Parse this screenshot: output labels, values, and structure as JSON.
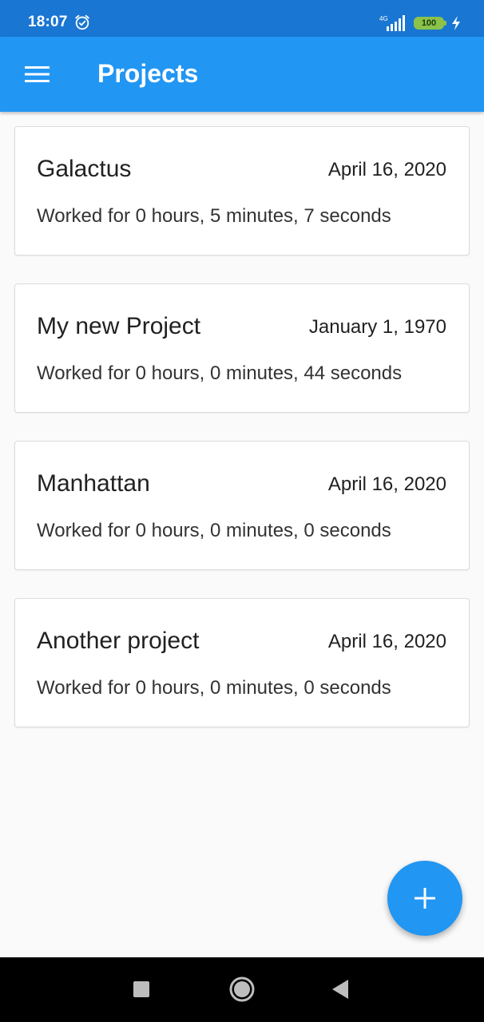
{
  "status_bar": {
    "time": "18:07",
    "battery_level": "100",
    "network_label": "4G",
    "icons": [
      "alarm-icon",
      "signal-icon",
      "battery-icon",
      "charging-icon"
    ]
  },
  "app_bar": {
    "title": "Projects",
    "menu_icon": "hamburger-menu-icon",
    "background_color": "#2196f3"
  },
  "projects": [
    {
      "name": "Galactus",
      "date": "April 16, 2020",
      "worked": "Worked for 0 hours, 5 minutes, 7 seconds"
    },
    {
      "name": "My new Project",
      "date": "January 1, 1970",
      "worked": "Worked for 0 hours, 0 minutes, 44 seconds"
    },
    {
      "name": "Manhattan",
      "date": "April 16, 2020",
      "worked": "Worked for 0 hours, 0 minutes, 0 seconds"
    },
    {
      "name": "Another project",
      "date": "April 16, 2020",
      "worked": "Worked for 0 hours, 0 minutes, 0 seconds"
    }
  ],
  "fab": {
    "icon": "plus-icon",
    "color": "#2196f3"
  },
  "nav_bar": {
    "icons": [
      "recents-icon",
      "home-icon",
      "back-icon"
    ]
  }
}
